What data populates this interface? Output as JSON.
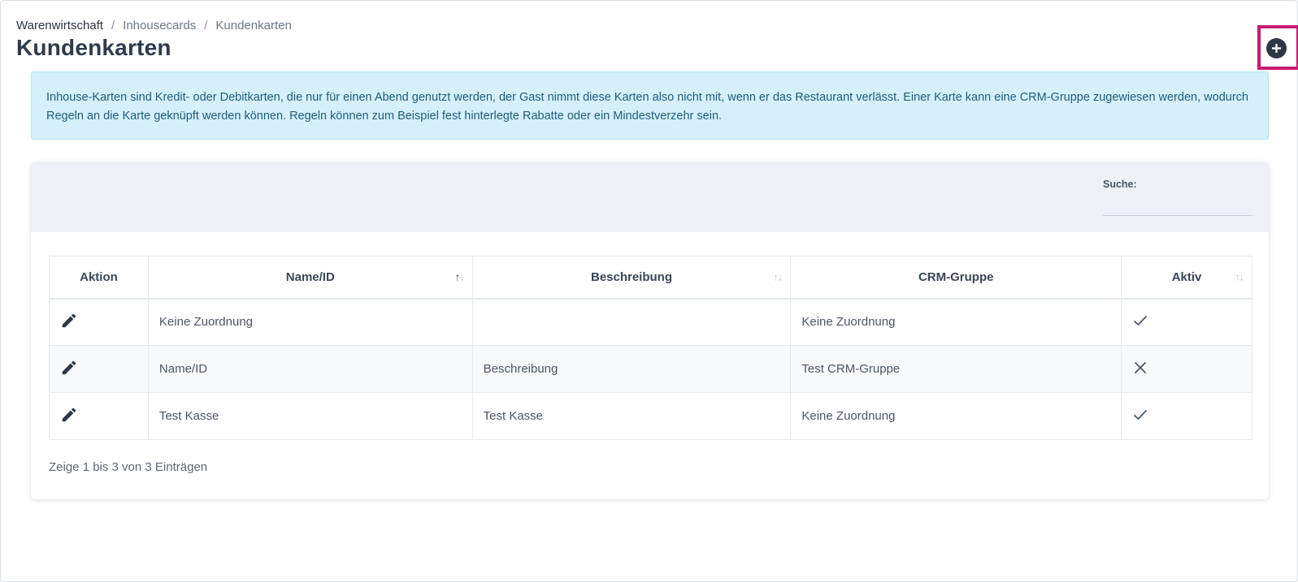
{
  "breadcrumb": [
    "Warenwirtschaft",
    "Inhousecards",
    "Kundenkarten"
  ],
  "page": {
    "title": "Kundenkarten"
  },
  "add_button": {
    "icon": "plus-circle-icon",
    "highlight_color": "#c81a73"
  },
  "info": {
    "text": "Inhouse-Karten sind Kredit- oder Debitkarten, die nur für einen Abend genutzt werden, der Gast nimmt diese Karten also nicht mit, wenn er das Restaurant verlässt. Einer Karte kann eine CRM-Gruppe zugewiesen werden, wodurch Regeln an die Karte geknüpft werden können. Regeln können zum Beispiel fest hinterlegte Rabatte oder ein Mindestverzehr sein."
  },
  "search": {
    "label": "Suche:",
    "value": ""
  },
  "table": {
    "columns": [
      "Aktion",
      "Name/ID",
      "Beschreibung",
      "CRM-Gruppe",
      "Aktiv"
    ],
    "rows": [
      {
        "name": "Keine Zuordnung",
        "description": "",
        "crm_group": "Keine Zuordnung",
        "active": true
      },
      {
        "name": "Name/ID",
        "description": "Beschreibung",
        "crm_group": "Test CRM-Gruppe",
        "active": false
      },
      {
        "name": "Test Kasse",
        "description": "Test Kasse",
        "crm_group": "Keine Zuordnung",
        "active": true
      }
    ]
  },
  "footer": {
    "info": "Zeige 1 bis 3 von 3 Einträgen"
  },
  "colors": {
    "info_bg": "#d5f0fb",
    "header_bg": "#edf1f6",
    "text_dark": "#2f3b4c"
  }
}
